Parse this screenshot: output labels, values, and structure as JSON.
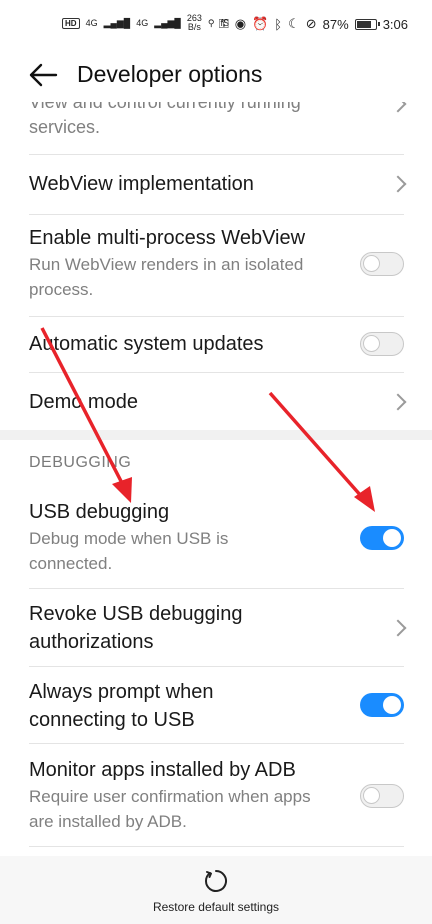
{
  "status_bar": {
    "hd_badge": "HD",
    "signal_1": "4G",
    "signal_2": "4G",
    "net_speed": "263",
    "net_speed_unit": "B/s",
    "misc": "fS",
    "battery_percent": "87%",
    "battery_level": 0.87,
    "time": "3:06"
  },
  "app_bar": {
    "title": "Developer options"
  },
  "items": [
    {
      "subtitle": "View and control currently running services."
    },
    {
      "title": "WebView implementation"
    },
    {
      "title": "Enable multi-process WebView",
      "subtitle": "Run WebView renders in an isolated process.",
      "toggle": false
    },
    {
      "title": "Automatic system updates",
      "toggle": false
    },
    {
      "title": "Demo mode"
    }
  ],
  "section": {
    "header": "DEBUGGING"
  },
  "debug_items": [
    {
      "title": "USB debugging",
      "subtitle": "Debug mode when USB is connected.",
      "toggle": true
    },
    {
      "title": "Revoke USB debugging authorizations"
    },
    {
      "title": "Always prompt when connecting to USB",
      "toggle": true
    },
    {
      "title": "Monitor apps installed by ADB",
      "subtitle": "Require user confirmation when apps are installed by ADB.",
      "toggle": false
    }
  ],
  "bottom": {
    "restore_label": "Restore default settings"
  },
  "colors": {
    "accent": "#1a8cff",
    "annotation_arrow": "#e8232a"
  }
}
